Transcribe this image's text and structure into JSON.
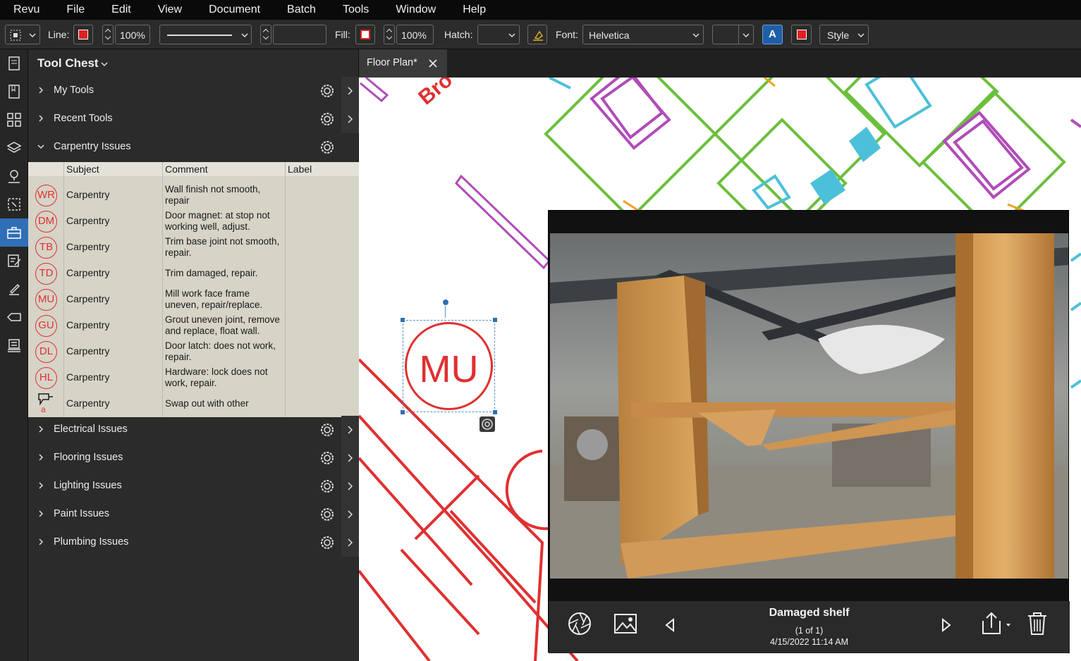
{
  "menu": [
    "Revu",
    "File",
    "Edit",
    "View",
    "Document",
    "Batch",
    "Tools",
    "Window",
    "Help"
  ],
  "toolbar": {
    "line_label": "Line:",
    "line_opacity": "100%",
    "fill_label": "Fill:",
    "fill_opacity": "100%",
    "hatch_label": "Hatch:",
    "font_label": "Font:",
    "font_value": "Helvetica",
    "style_label": "Style",
    "text_color_glyph": "A",
    "line_color": "#e02020",
    "fill_color": "#e02020",
    "text_box_color": "#1e5fa8"
  },
  "chest": {
    "title": "Tool Chest",
    "groups": [
      {
        "label": "My Tools",
        "expanded": false
      },
      {
        "label": "Recent Tools",
        "expanded": false
      },
      {
        "label": "Carpentry Issues",
        "expanded": true
      },
      {
        "label": "Electrical Issues",
        "expanded": false
      },
      {
        "label": "Flooring Issues",
        "expanded": false
      },
      {
        "label": "Lighting Issues",
        "expanded": false
      },
      {
        "label": "Paint Issues",
        "expanded": false
      },
      {
        "label": "Plumbing Issues",
        "expanded": false
      }
    ],
    "table_headers": [
      "Subject",
      "Comment",
      "Label"
    ],
    "rows": [
      {
        "badge": "WR",
        "subject": "Carpentry",
        "comment": "Wall finish not smooth, repair"
      },
      {
        "badge": "DM",
        "subject": "Carpentry",
        "comment": "Door magnet: at stop not working well, adjust."
      },
      {
        "badge": "TB",
        "subject": "Carpentry",
        "comment": "Trim base joint not smooth, repair."
      },
      {
        "badge": "TD",
        "subject": "Carpentry",
        "comment": "Trim damaged, repair."
      },
      {
        "badge": "MU",
        "subject": "Carpentry",
        "comment": "Mill work face frame uneven, repair/replace."
      },
      {
        "badge": "GU",
        "subject": "Carpentry",
        "comment": "Grout uneven joint, remove and replace, float wall."
      },
      {
        "badge": "DL",
        "subject": "Carpentry",
        "comment": "Door latch: does not work, repair."
      },
      {
        "badge": "HL",
        "subject": "Carpentry",
        "comment": "Hardware: lock does not work, repair."
      },
      {
        "badge": "a",
        "subject": "Carpentry",
        "comment": "Swap out with other"
      }
    ]
  },
  "document": {
    "tab_label": "Floor Plan*",
    "canvas_text_fragment": "Bro",
    "selected_markup": "MU"
  },
  "viewer": {
    "title": "Damaged shelf",
    "count": "(1 of 1)",
    "date": "4/15/2022 11:14 AM"
  },
  "colors": {
    "markup_red": "#e03030",
    "plan_green": "#6cbf3c",
    "plan_magenta": "#b04cb8",
    "plan_cyan": "#4cc0d8",
    "plan_orange": "#f0a020",
    "accent_blue": "#2f6fb8"
  }
}
